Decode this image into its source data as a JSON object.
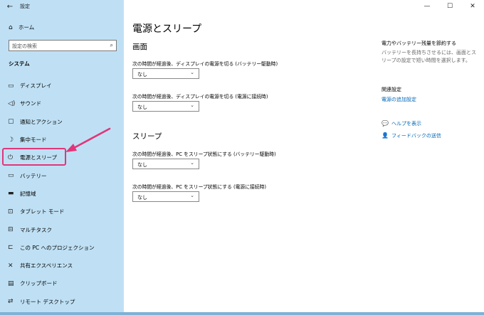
{
  "window": {
    "title": "設定",
    "back_glyph": "←",
    "min_glyph": "—",
    "max_glyph": "☐",
    "close_glyph": "✕"
  },
  "sidebar": {
    "home_label": "ホーム",
    "search_placeholder": "設定の検索",
    "section_label": "システム",
    "items": [
      {
        "label": "ディスプレイ",
        "icon": "▭"
      },
      {
        "label": "サウンド",
        "icon": "◁)"
      },
      {
        "label": "通知とアクション",
        "icon": "▢"
      },
      {
        "label": "集中モード",
        "icon": "☽"
      },
      {
        "label": "電源とスリープ",
        "icon": "⏻"
      },
      {
        "label": "バッテリー",
        "icon": "▭"
      },
      {
        "label": "記憶域",
        "icon": "▬"
      },
      {
        "label": "タブレット モード",
        "icon": "⊡"
      },
      {
        "label": "マルチタスク",
        "icon": "⊟"
      },
      {
        "label": "この PC へのプロジェクション",
        "icon": "⊏"
      },
      {
        "label": "共有エクスペリエンス",
        "icon": "✕"
      },
      {
        "label": "クリップボード",
        "icon": "▤"
      },
      {
        "label": "リモート デスクトップ",
        "icon": "⇄"
      }
    ]
  },
  "main": {
    "title": "電源とスリープ",
    "screen_section": "画面",
    "screen_battery_label": "次の時間が経過後、ディスプレイの電源を切る (バッテリー駆動時)",
    "screen_battery_value": "なし",
    "screen_plugged_label": "次の時間が経過後、ディスプレイの電源を切る (電源に接続時)",
    "screen_plugged_value": "なし",
    "sleep_section": "スリープ",
    "sleep_battery_label": "次の時間が経過後、PC をスリープ状態にする (バッテリー駆動時)",
    "sleep_battery_value": "なし",
    "sleep_plugged_label": "次の時間が経過後、PC をスリープ状態にする (電源に接続時)",
    "sleep_plugged_value": "なし"
  },
  "right": {
    "save_title": "電力やバッテリー残量を節約する",
    "save_desc": "バッテリーを長持ちさせるには、画面とスリープの設定で短い時間を選択します。",
    "related_title": "関連設定",
    "related_link": "電源の追加設定",
    "help_link": "ヘルプを表示",
    "feedback_link": "フィードバックの送信"
  },
  "colors": {
    "sidebar_bg": "#bfe0f4",
    "highlight": "#e2357a",
    "link": "#0067b8"
  }
}
